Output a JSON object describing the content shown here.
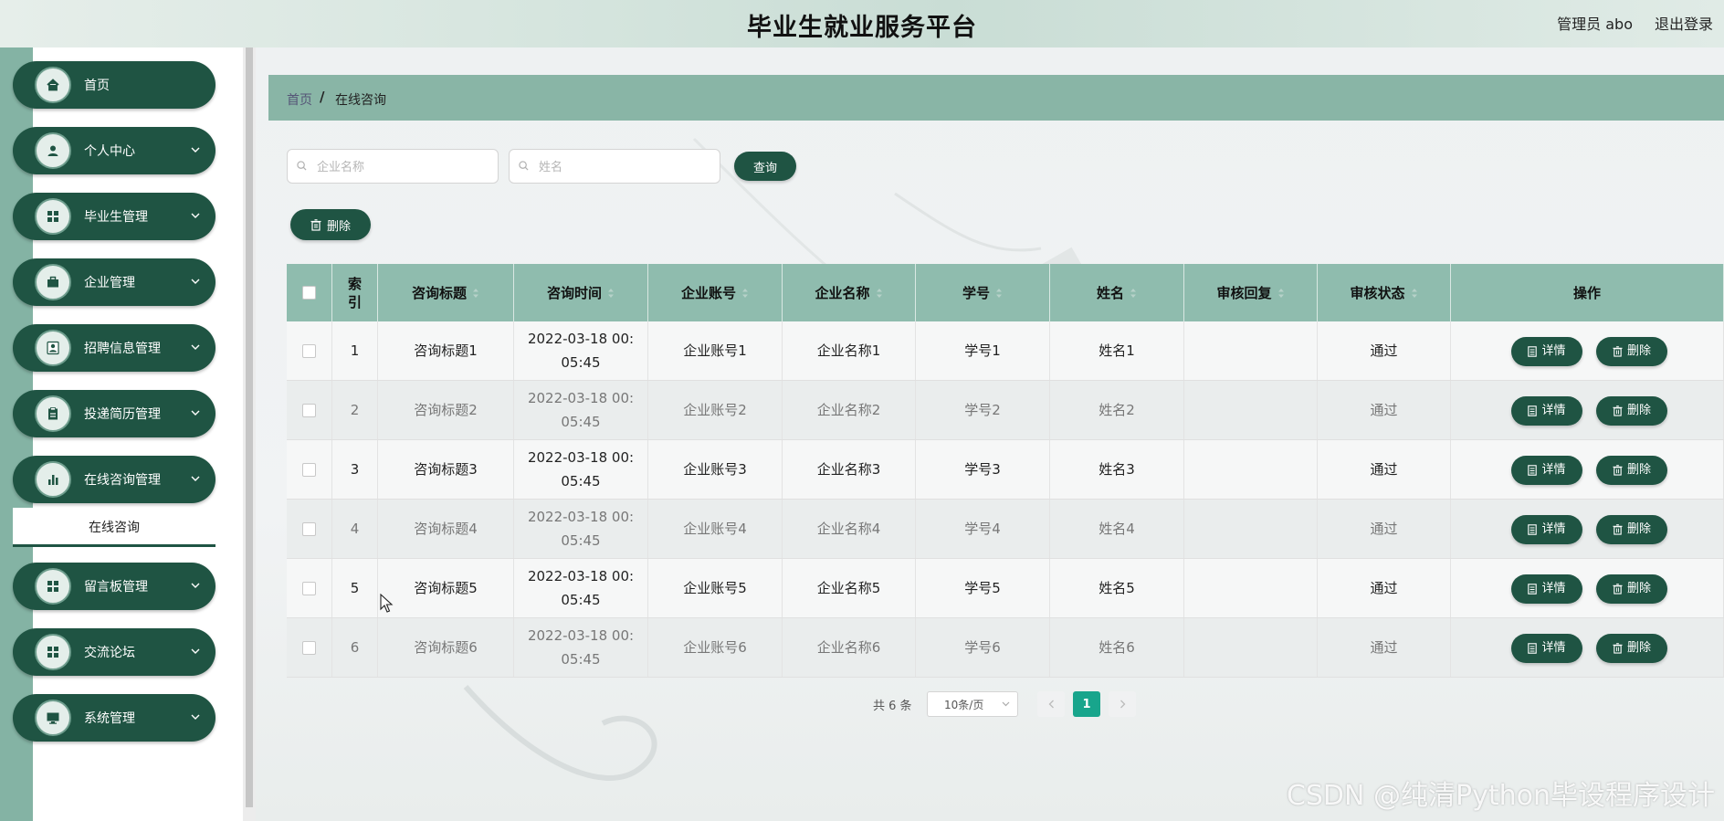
{
  "header": {
    "title": "毕业生就业服务平台",
    "user": "管理员 abo",
    "logout": "退出登录"
  },
  "sidebar": {
    "items": [
      {
        "label": "首页",
        "icon": "home-icon",
        "expandable": false
      },
      {
        "label": "个人中心",
        "icon": "user-icon",
        "expandable": true
      },
      {
        "label": "毕业生管理",
        "icon": "grid-icon",
        "expandable": true
      },
      {
        "label": "企业管理",
        "icon": "briefcase-icon",
        "expandable": true
      },
      {
        "label": "招聘信息管理",
        "icon": "user-badge-icon",
        "expandable": true
      },
      {
        "label": "投递简历管理",
        "icon": "clipboard-icon",
        "expandable": true
      },
      {
        "label": "在线咨询管理",
        "icon": "bar-chart-icon",
        "expandable": true
      },
      {
        "label": "留言板管理",
        "icon": "grid-icon",
        "expandable": true
      },
      {
        "label": "交流论坛",
        "icon": "grid-icon",
        "expandable": true
      },
      {
        "label": "系统管理",
        "icon": "monitor-icon",
        "expandable": true
      }
    ],
    "submenu": {
      "label": "在线咨询"
    }
  },
  "breadcrumb": {
    "home": "首页",
    "separator": "/",
    "current": "在线咨询"
  },
  "search": {
    "company_placeholder": "企业名称",
    "name_placeholder": "姓名",
    "query_button": "查询"
  },
  "toolbar": {
    "delete_button": "删除"
  },
  "table": {
    "headers": [
      "索\n引",
      "咨询标题",
      "咨询时间",
      "企业账号",
      "企业名称",
      "学号",
      "姓名",
      "审核回复",
      "审核状态",
      "操作"
    ],
    "rows": [
      {
        "index": "1",
        "title": "咨询标题1",
        "time": "2022-03-18 00:\n05:45",
        "account": "企业账号1",
        "company": "企业名称1",
        "student_id": "学号1",
        "name": "姓名1",
        "reply": "",
        "status": "通过"
      },
      {
        "index": "2",
        "title": "咨询标题2",
        "time": "2022-03-18 00:\n05:45",
        "account": "企业账号2",
        "company": "企业名称2",
        "student_id": "学号2",
        "name": "姓名2",
        "reply": "",
        "status": "通过"
      },
      {
        "index": "3",
        "title": "咨询标题3",
        "time": "2022-03-18 00:\n05:45",
        "account": "企业账号3",
        "company": "企业名称3",
        "student_id": "学号3",
        "name": "姓名3",
        "reply": "",
        "status": "通过"
      },
      {
        "index": "4",
        "title": "咨询标题4",
        "time": "2022-03-18 00:\n05:45",
        "account": "企业账号4",
        "company": "企业名称4",
        "student_id": "学号4",
        "name": "姓名4",
        "reply": "",
        "status": "通过"
      },
      {
        "index": "5",
        "title": "咨询标题5",
        "time": "2022-03-18 00:\n05:45",
        "account": "企业账号5",
        "company": "企业名称5",
        "student_id": "学号5",
        "name": "姓名5",
        "reply": "",
        "status": "通过"
      },
      {
        "index": "6",
        "title": "咨询标题6",
        "time": "2022-03-18 00:\n05:45",
        "account": "企业账号6",
        "company": "企业名称6",
        "student_id": "学号6",
        "name": "姓名6",
        "reply": "",
        "status": "通过"
      }
    ],
    "action_detail": "详情",
    "action_delete": "删除"
  },
  "pagination": {
    "total": "共 6 条",
    "page_size": "10条/页",
    "current_page": "1"
  },
  "watermark": "CSDN @纯清Python毕设程序设计",
  "colors": {
    "primary": "#1f5443",
    "header_bg": "#8fbcae",
    "breadcrumb_bg": "#89b5a6",
    "page_active": "#18a58c"
  }
}
